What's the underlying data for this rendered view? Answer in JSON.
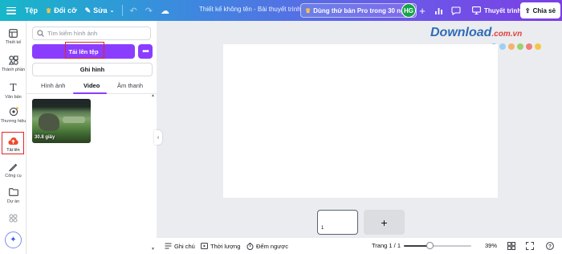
{
  "topbar": {
    "home_label": "Tệp",
    "resize_label": "Đổi cỡ",
    "edit_label": "Sửa",
    "doc_title": "Thiết kế không tên - Bài thuyết trình",
    "pro_label": "Dùng thử bản Pro trong 30 ngày",
    "avatar_initials": "HG",
    "present_label": "Thuyết trình",
    "share_label": "Chia sẻ"
  },
  "rail": {
    "items": [
      {
        "label": "Thiết kế",
        "icon": "layout-icon"
      },
      {
        "label": "Thành phần",
        "icon": "shapes-icon"
      },
      {
        "label": "Văn bản",
        "icon": "text-icon"
      },
      {
        "label": "Thương hiệu",
        "icon": "brand-icon"
      },
      {
        "label": "Tải lên",
        "icon": "upload-cloud-icon"
      },
      {
        "label": "Công cụ",
        "icon": "draw-icon"
      },
      {
        "label": "Dự án",
        "icon": "folder-icon"
      },
      {
        "label": "",
        "icon": "apps-icon"
      }
    ]
  },
  "panel": {
    "search_placeholder": "Tìm kiếm hình ảnh",
    "upload_button": "Tải lên tệp",
    "record_button": "Ghi hình",
    "tabs": [
      "Hình ảnh",
      "Video",
      "Âm thanh"
    ],
    "active_tab": "Video",
    "video_duration": "30.8 giây"
  },
  "watermark": {
    "brand": "Download",
    "domain": ".com.vn",
    "dot_colors": [
      "#6fc7ea",
      "#9dd0f2",
      "#f2b46a",
      "#9bd26a",
      "#ef7e7e",
      "#f2c84a"
    ]
  },
  "pages": {
    "current_thumb_number": "1",
    "add_page_symbol": "+"
  },
  "bottombar": {
    "notes_label": "Ghi chú",
    "duration_label": "Thời lượng",
    "timer_label": "Đếm ngược",
    "page_indicator": "Trang 1 / 1",
    "zoom_label": "39%",
    "zoom_fraction": 0.39
  },
  "colors": {
    "accent": "#8b3dff",
    "highlight": "#e0252b"
  }
}
